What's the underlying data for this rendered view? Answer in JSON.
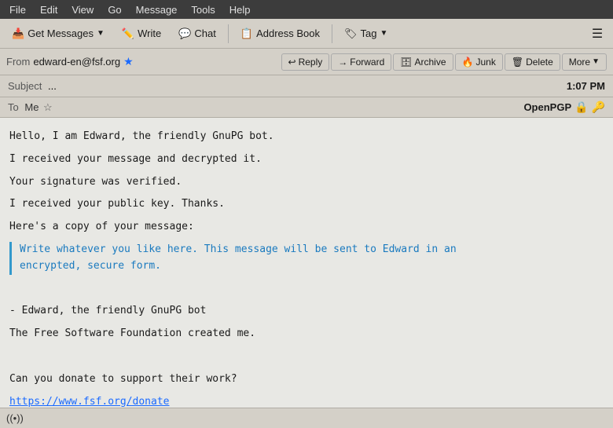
{
  "menubar": {
    "items": [
      {
        "label": "File",
        "id": "file"
      },
      {
        "label": "Edit",
        "id": "edit"
      },
      {
        "label": "View",
        "id": "view"
      },
      {
        "label": "Go",
        "id": "go"
      },
      {
        "label": "Message",
        "id": "message"
      },
      {
        "label": "Tools",
        "id": "tools"
      },
      {
        "label": "Help",
        "id": "help"
      }
    ]
  },
  "toolbar": {
    "get_messages_label": "Get Messages",
    "write_label": "Write",
    "chat_label": "Chat",
    "address_book_label": "Address Book",
    "tag_label": "Tag"
  },
  "actionbar": {
    "from_label": "From",
    "from_address": "edward-en@fsf.org",
    "buttons": {
      "reply": "Reply",
      "forward": "Forward",
      "archive": "Archive",
      "junk": "Junk",
      "delete": "Delete",
      "more": "More"
    }
  },
  "subjectbar": {
    "subject_label": "Subject",
    "subject_value": "...",
    "time": "1:07 PM"
  },
  "tobar": {
    "to_label": "To",
    "to_name": "Me",
    "openpgp_label": "OpenPGP"
  },
  "message": {
    "line1": "Hello, I am Edward, the friendly GnuPG bot.",
    "line2": "I received your message and decrypted it.",
    "line3": "Your signature was verified.",
    "line4": "I received your public key. Thanks.",
    "line5": "Here's a copy of your message:",
    "quoted1": "Write whatever you like here. This message will be sent to Edward in an",
    "quoted2": "encrypted, secure form.",
    "signature1": "- Edward, the friendly GnuPG bot",
    "signature2": "The Free Software Foundation created me.",
    "donate_text": "Can you donate to support their work?",
    "donate_link": "https://www.fsf.org/donate"
  },
  "statusbar": {
    "signal_icon": "📶"
  }
}
